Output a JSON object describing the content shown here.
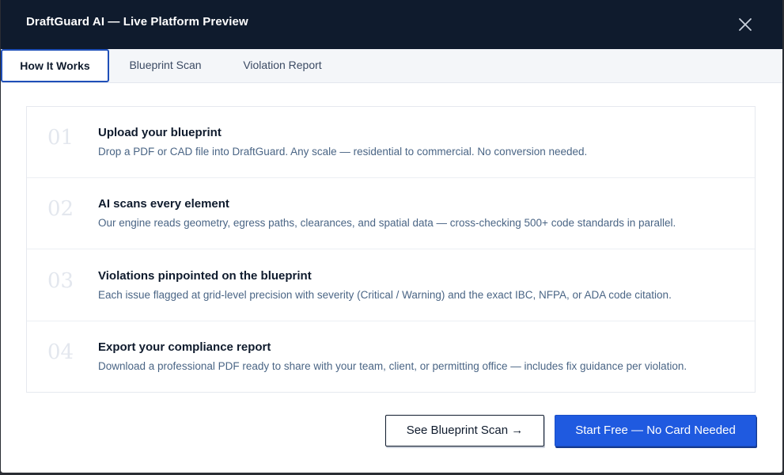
{
  "window": {
    "title": "DraftGuard AI — Live Platform Preview",
    "close_icon": "close-icon"
  },
  "tabs": [
    {
      "label": "How It Works",
      "active": true
    },
    {
      "label": "Blueprint Scan",
      "active": false
    },
    {
      "label": "Violation Report",
      "active": false
    }
  ],
  "steps": [
    {
      "number": "01",
      "title": "Upload your blueprint",
      "description": "Drop a PDF or CAD file into DraftGuard. Any scale — residential to commercial. No conversion needed."
    },
    {
      "number": "02",
      "title": "AI scans every element",
      "description": "Our engine reads geometry, egress paths, clearances, and spatial data — cross-checking 500+ code standards in parallel."
    },
    {
      "number": "03",
      "title": "Violations pinpointed on the blueprint",
      "description": "Each issue flagged at grid-level precision with severity (Critical / Warning) and the exact IBC, NFPA, or ADA code citation."
    },
    {
      "number": "04",
      "title": "Export your compliance report",
      "description": "Download a professional PDF ready to share with your team, client, or permitting office — includes fix guidance per violation."
    }
  ],
  "actions": {
    "secondary_label": "See Blueprint Scan →",
    "primary_label": "Start Free — No Card Needed"
  },
  "colors": {
    "header_bg": "#0f1b2d",
    "accent": "#1f5ae0",
    "active_tab_border": "#1f4fb8",
    "desc_text": "#4a6585"
  }
}
